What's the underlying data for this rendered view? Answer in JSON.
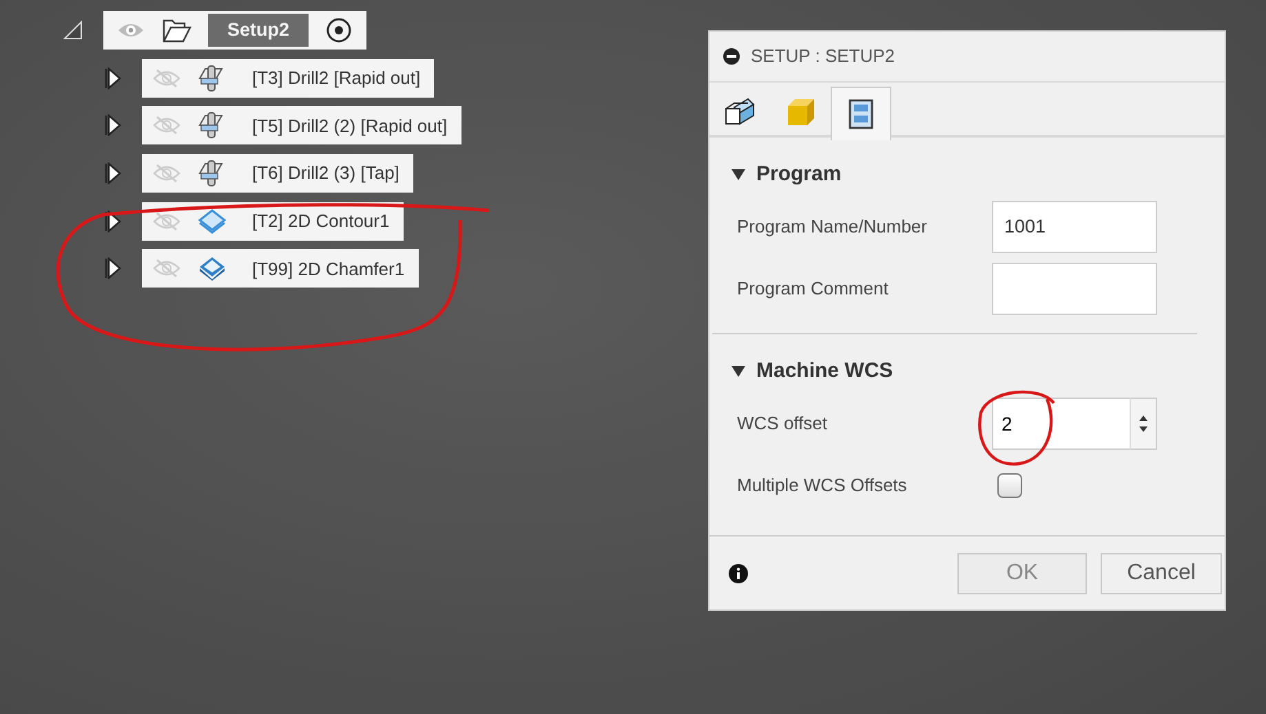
{
  "tree": {
    "setup": {
      "label": "Setup2",
      "expanded": true,
      "visible": true
    },
    "operations": [
      {
        "label": "[T3] Drill2 [Rapid out]",
        "kind": "drill",
        "visible": false,
        "expanded": false
      },
      {
        "label": "[T5] Drill2 (2) [Rapid out]",
        "kind": "drill",
        "visible": false,
        "expanded": false
      },
      {
        "label": "[T6] Drill2 (3) [Tap]",
        "kind": "drill",
        "visible": false,
        "expanded": false
      },
      {
        "label": "[T2] 2D Contour1",
        "kind": "contour",
        "visible": false,
        "expanded": false
      },
      {
        "label": "[T99] 2D Chamfer1",
        "kind": "chamfer",
        "visible": false,
        "expanded": false
      }
    ]
  },
  "dialog": {
    "title": "SETUP : SETUP2",
    "tabs": [
      {
        "kind": "setup",
        "selected": false
      },
      {
        "kind": "stock",
        "selected": false
      },
      {
        "kind": "post",
        "selected": true
      }
    ],
    "sections": [
      {
        "title": "Program",
        "expanded": true,
        "fields": [
          {
            "label": "Program Name/Number",
            "kind": "text",
            "value": "1001"
          },
          {
            "label": "Program Comment",
            "kind": "text"
          }
        ]
      },
      {
        "title": "Machine WCS",
        "expanded": true,
        "fields": [
          {
            "label": "WCS offset",
            "kind": "spinner",
            "value": "2"
          },
          {
            "label": "Multiple WCS Offsets",
            "kind": "checkbox",
            "checked": false
          }
        ]
      }
    ],
    "buttons": [
      {
        "label": "OK",
        "disabled": true
      },
      {
        "label": "Cancel",
        "disabled": false
      }
    ]
  }
}
